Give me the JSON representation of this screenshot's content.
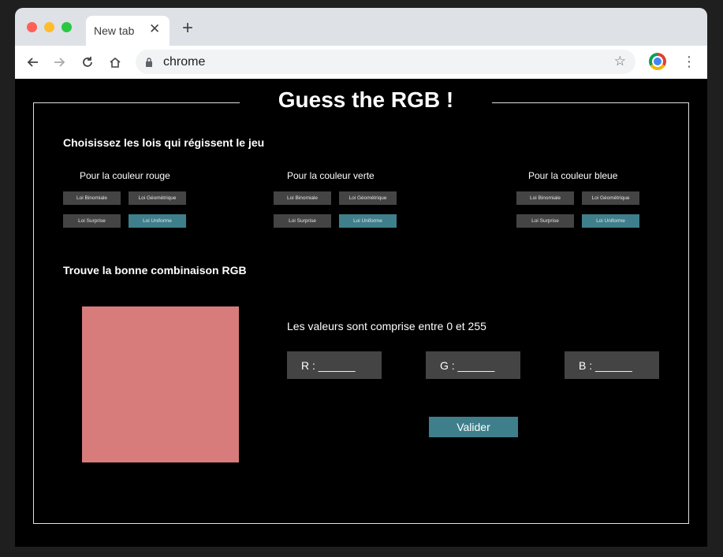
{
  "browser": {
    "tab_title": "New tab",
    "tab_close_icon": "close-icon",
    "new_tab_icon": "plus-icon",
    "url": "chrome"
  },
  "page": {
    "title": "Guess the RGB !",
    "laws_heading": "Choisissez les lois qui régissent le jeu",
    "colors": [
      {
        "heading": "Pour la couleur rouge",
        "buttons": [
          "Loi Binomiale",
          "Loi Géométrique",
          "Loi Surprise",
          "Loi Uniforme"
        ],
        "active": "Loi Uniforme"
      },
      {
        "heading": "Pour la couleur verte",
        "buttons": [
          "Loi Binomiale",
          "Loi Géométrique",
          "Loi Surprise",
          "Loi Uniforme"
        ],
        "active": "Loi Uniforme"
      },
      {
        "heading": "Pour la couleur bleue",
        "buttons": [
          "Loi Binomiale",
          "Loi Géométrique",
          "Loi Surprise",
          "Loi Uniforme"
        ],
        "active": "Loi Uniforme"
      }
    ],
    "guess_heading": "Trouve la bonne combinaison RGB",
    "swatch_color": "#d77b7b",
    "range_text": "Les valeurs sont comprise entre 0 et 255",
    "fields": {
      "r": "R : ______",
      "g": "G : ______",
      "b": "B : ______"
    },
    "validate_label": "Valider"
  }
}
